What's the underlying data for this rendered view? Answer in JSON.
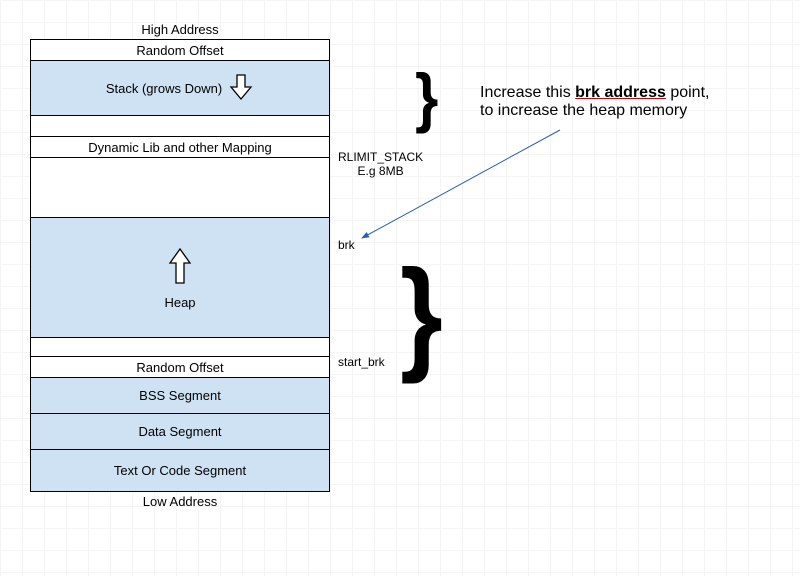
{
  "labels": {
    "high_address": "High Address",
    "low_address": "Low Address"
  },
  "segments": {
    "random_offset_top": "Random Offset",
    "stack": "Stack (grows Down)",
    "dyn_lib": "Dynamic Lib and other Mapping",
    "heap": "Heap",
    "random_offset_bottom": "Random Offset",
    "bss": "BSS Segment",
    "data": "Data Segment",
    "text": "Text Or Code Segment"
  },
  "side": {
    "rlimit_stack": "RLIMIT_STACK",
    "rlimit_example": "E.g 8MB",
    "brk": "brk",
    "start_brk": "start_brk"
  },
  "annotation": {
    "line1_pre": "Increase this ",
    "line1_bold": "brk address",
    "line1_post": " point,",
    "line2": "to increase the heap memory"
  }
}
